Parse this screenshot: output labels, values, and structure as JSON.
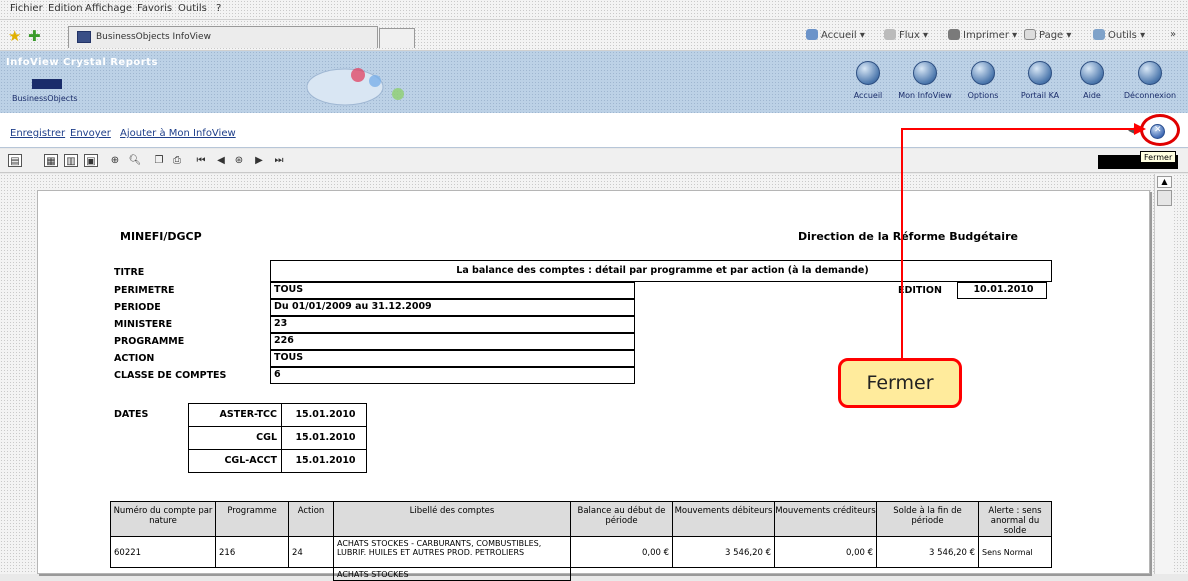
{
  "menu": [
    "Fichier",
    "Edition",
    "Affichage",
    "Favoris",
    "Outils",
    "?"
  ],
  "tab": {
    "title": "BusinessObjects InfoView"
  },
  "ie_toolbar": {
    "home": "Accueil",
    "feeds": "Flux",
    "print": "Imprimer",
    "page": "Page",
    "tools": "Outils",
    "more": "»"
  },
  "bo": {
    "app_name": "InfoView Crystal Reports",
    "logo": "BusinessObjects",
    "nav": [
      {
        "label": "Accueil",
        "icon": "home-icon"
      },
      {
        "label": "Mon InfoView",
        "icon": "my-infoview-icon"
      },
      {
        "label": "Options",
        "icon": "options-icon"
      },
      {
        "label": "Portail KA",
        "icon": "portal-icon"
      },
      {
        "label": "Aide",
        "icon": "help-icon"
      },
      {
        "label": "Déconnexion",
        "icon": "logout-icon"
      }
    ]
  },
  "actions": {
    "save": "Enregistrer",
    "send": "Envoyer",
    "add": "Ajouter à Mon InfoView",
    "close_tooltip": "Fermer"
  },
  "report": {
    "org": "MINEFI/DGCP",
    "direction": "Direction de la Réforme Budgétaire",
    "fields": {
      "titre_label": "TITRE",
      "titre_value": "La balance des comptes : détail par programme et par action (à la demande)",
      "perimetre_label": "PERIMETRE",
      "perimetre_value": "TOUS",
      "periode_label": "PERIODE",
      "periode_value": "Du 01/01/2009 au 31.12.2009",
      "ministere_label": "MINISTERE",
      "ministere_value": "23",
      "programme_label": "PROGRAMME",
      "programme_value": "226",
      "action_label": "ACTION",
      "action_value": "TOUS",
      "classe_label": "CLASSE DE COMPTES",
      "classe_value": "6",
      "edition_label": "EDITION",
      "edition_value": "10.01.2010"
    },
    "dates_label": "DATES",
    "dates": [
      {
        "source": "ASTER-TCC",
        "date": "15.01.2010"
      },
      {
        "source": "CGL",
        "date": "15.01.2010"
      },
      {
        "source": "CGL-ACCT",
        "date": "15.01.2010"
      }
    ],
    "table": {
      "headers": [
        "Numéro du compte par nature",
        "Programme",
        "Action",
        "Libellé des comptes",
        "Balance au début de période",
        "Mouvements débiteurs",
        "Mouvements créditeurs",
        "Solde à la fin de période",
        "Alerte : sens anormal du solde"
      ],
      "rows": [
        {
          "compte": "60221",
          "programme": "216",
          "action": "24",
          "libelle": "ACHATS STOCKES - CARBURANTS, COMBUSTIBLES, LUBRIF. HUILES ET AUTRES PROD. PETROLIERS",
          "debut": "0,00 €",
          "debit": "3 546,20 €",
          "credit": "0,00 €",
          "fin": "3 546,20 €",
          "alerte": "Sens Normal"
        },
        {
          "compte": "",
          "programme": "",
          "action": "",
          "libelle": "ACHATS STOCKES",
          "debut": "",
          "debit": "",
          "credit": "",
          "fin": "",
          "alerte": ""
        }
      ]
    }
  },
  "annotation": {
    "label": "Fermer",
    "color": "#ff0000",
    "fill": "#ffeb9c"
  }
}
